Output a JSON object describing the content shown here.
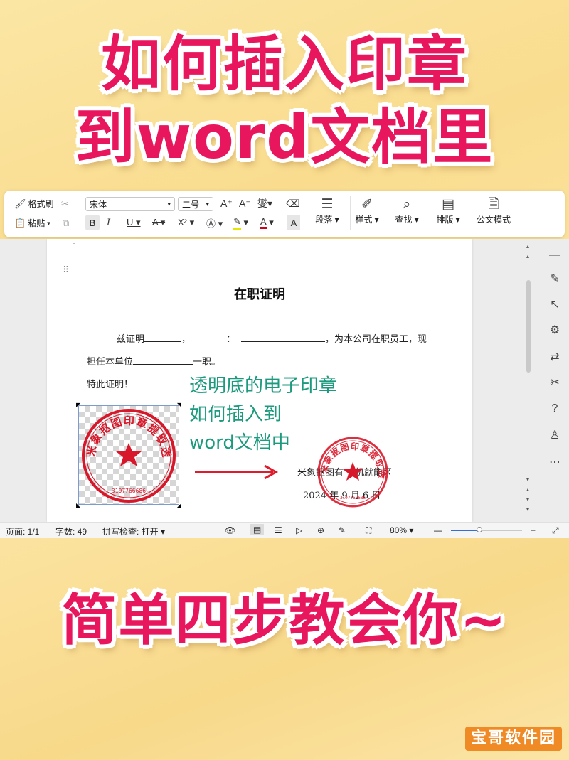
{
  "headline": {
    "line1": "如何插入印章",
    "line2": "到word文档里",
    "line3": "简单四步教会你~"
  },
  "toolbar": {
    "format_painter": "格式刷",
    "paste": "粘贴",
    "font_name": "宋体",
    "font_size": "二号",
    "paragraph": "段落",
    "style": "样式",
    "find": "查找",
    "layout": "排版",
    "official_mode": "公文模式"
  },
  "document": {
    "title": "在职证明",
    "line1_a": "兹证明",
    "line1_b": "，",
    "line1_c": "：",
    "line1_d": "，为本公司在职员工，现",
    "line2_a": "担任本单位",
    "line2_b": "一职。",
    "line3": "特此证明！",
    "company": "米象抠图有",
    "company_tail": "机就能区",
    "date": "2024 年 9 月 6 日"
  },
  "annotation": {
    "line1": "透明底的电子印章",
    "line2": "如何插入到",
    "line3": "word文档中"
  },
  "stamp": {
    "ring_text": "米象抠图印章提取透明底",
    "number": "3107766686"
  },
  "status": {
    "page": "页面: 1/1",
    "words": "字数: 49",
    "spell": "拼写检查: 打开",
    "zoom": "80%"
  },
  "watermark": "宝哥软件园",
  "colors": {
    "headline": "#e8175d",
    "annotation": "#1b9a7d",
    "stamp": "#d8182a",
    "arrow": "#e01b2c",
    "watermark_bg": "#f08a24"
  }
}
